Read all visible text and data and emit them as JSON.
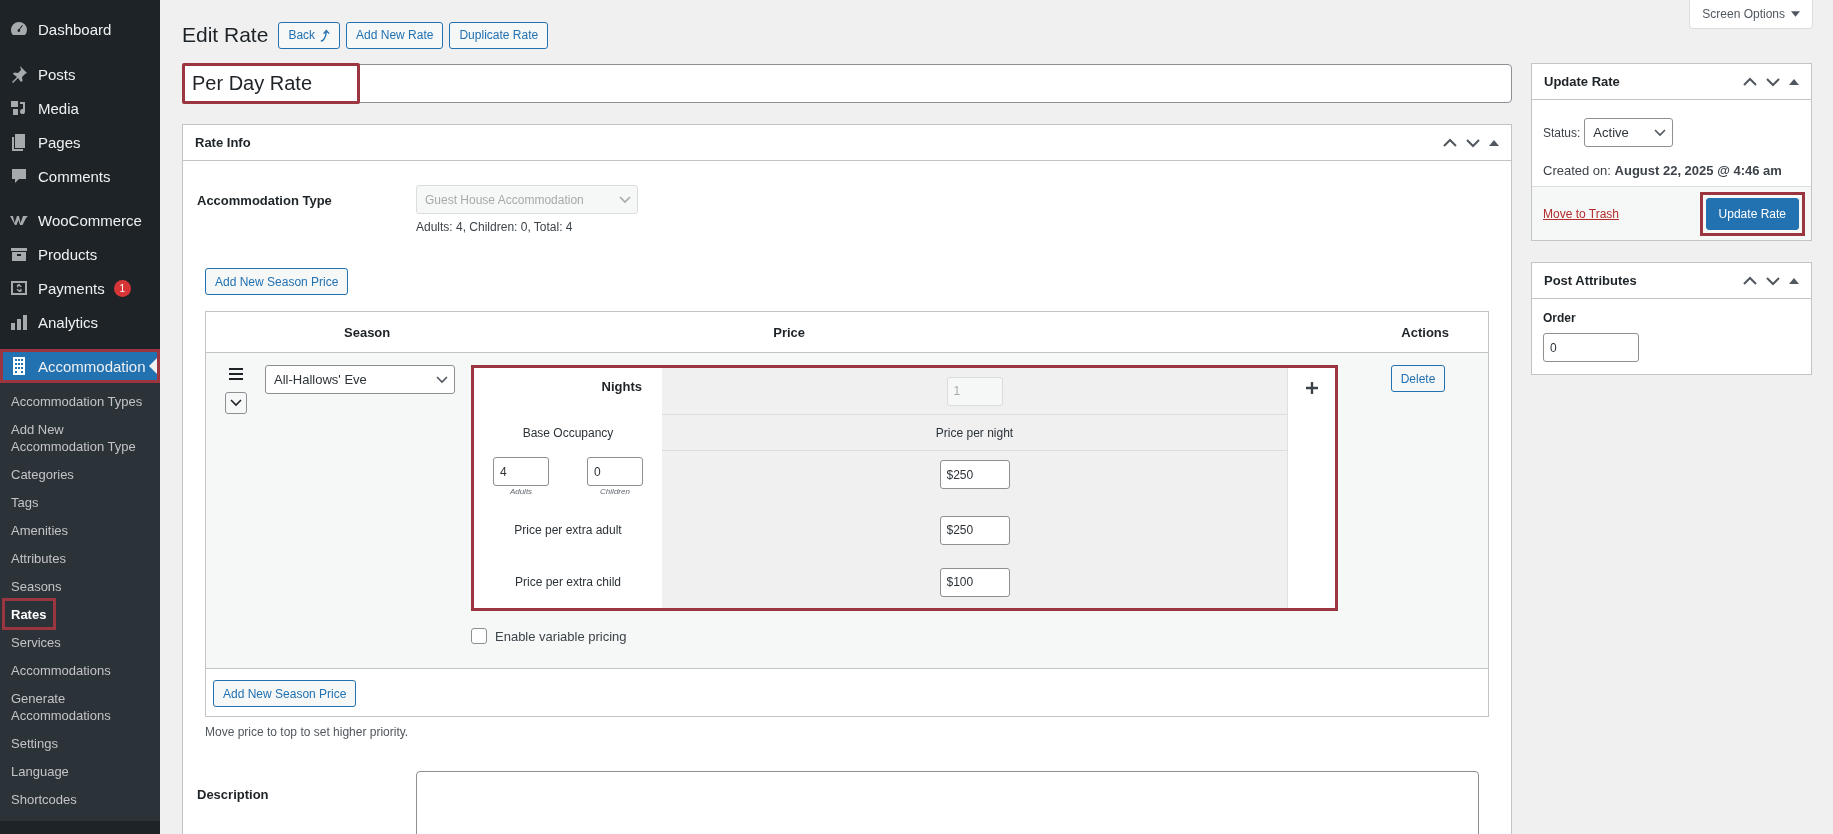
{
  "sidebar": {
    "groups": [
      {
        "items": [
          {
            "label": "Dashboard",
            "kind": "gauge",
            "current": false,
            "highlighted": false
          }
        ]
      },
      {
        "items": [
          {
            "label": "Posts",
            "kind": "pin",
            "current": false,
            "highlighted": false
          },
          {
            "label": "Media",
            "kind": "media",
            "current": false,
            "highlighted": false
          },
          {
            "label": "Pages",
            "kind": "pages",
            "current": false,
            "highlighted": false
          },
          {
            "label": "Comments",
            "kind": "comment",
            "current": false,
            "highlighted": false
          }
        ]
      },
      {
        "items": [
          {
            "label": "WooCommerce",
            "kind": "woo",
            "current": false,
            "highlighted": false
          },
          {
            "label": "Products",
            "kind": "box",
            "current": false,
            "highlighted": false
          },
          {
            "label": "Payments",
            "kind": "payment",
            "current": false,
            "highlighted": false,
            "badge": "1"
          },
          {
            "label": "Analytics",
            "kind": "bars",
            "current": false,
            "highlighted": false
          }
        ]
      },
      {
        "items": [
          {
            "label": "Accommodation",
            "kind": "building",
            "current": true,
            "highlighted": true,
            "children": [
              {
                "label": "Accommodation Types",
                "current": false,
                "highlighted": false
              },
              {
                "label": "Add New Accommodation Type",
                "current": false,
                "highlighted": false
              },
              {
                "label": "Categories",
                "current": false,
                "highlighted": false
              },
              {
                "label": "Tags",
                "current": false,
                "highlighted": false
              },
              {
                "label": "Amenities",
                "current": false,
                "highlighted": false
              },
              {
                "label": "Attributes",
                "current": false,
                "highlighted": false
              },
              {
                "label": "Seasons",
                "current": false,
                "highlighted": false
              },
              {
                "label": "Rates",
                "current": true,
                "highlighted": true
              },
              {
                "label": "Services",
                "current": false,
                "highlighted": false
              },
              {
                "label": "Accommodations",
                "current": false,
                "highlighted": false
              },
              {
                "label": "Generate Accommodations",
                "current": false,
                "highlighted": false
              },
              {
                "label": "Settings",
                "current": false,
                "highlighted": false
              },
              {
                "label": "Language",
                "current": false,
                "highlighted": false
              },
              {
                "label": "Shortcodes",
                "current": false,
                "highlighted": false
              }
            ]
          }
        ]
      }
    ]
  },
  "header": {
    "title": "Edit Rate",
    "buttons": [
      {
        "label": "Back",
        "kind": "back"
      },
      {
        "label": "Add New Rate",
        "kind": "plain"
      },
      {
        "label": "Duplicate Rate",
        "kind": "plain"
      }
    ]
  },
  "screen_options": "Screen Options",
  "title_field": {
    "value": "Per Day Rate",
    "highlighted": true
  },
  "rate_info": {
    "title": "Rate Info",
    "accommodation_type": {
      "label": "Accommodation Type",
      "value": "Guest House Accommodation",
      "disabled": true,
      "note": "Adults: 4, Children: 0, Total: 4"
    },
    "add_button": "Add New Season Price",
    "table": {
      "columns": [
        "Season",
        "Price",
        "Actions"
      ],
      "rows": [
        {
          "season": "All-Hallows' Eve",
          "action": "Delete",
          "prices": {
            "highlighted": true,
            "nights_label": "Nights",
            "nights_value": "1",
            "occupancy_label": "Base Occupancy",
            "per_night_label": "Price per night",
            "adults": {
              "value": "4",
              "caption": "Adults"
            },
            "children": {
              "value": "0",
              "caption": "Children"
            },
            "base_price": "$250",
            "extras": [
              {
                "label": "Price per extra adult",
                "value": "$250"
              },
              {
                "label": "Price per extra child",
                "value": "$100"
              }
            ]
          },
          "variable_pricing": {
            "label": "Enable variable pricing",
            "checked": false
          }
        }
      ],
      "footer_button": "Add New Season Price"
    },
    "hint": "Move price to top to set higher priority.",
    "description_label": "Description"
  },
  "update_panel": {
    "title": "Update Rate",
    "status_label": "Status:",
    "status": "Active",
    "created": "Created on: **August 22, 2025 @ 4:46 am**",
    "trash": "Move to Trash",
    "button": {
      "label": "Update Rate",
      "highlighted": true
    }
  },
  "attributes_panel": {
    "title": "Post Attributes",
    "order_label": "Order",
    "order_value": "0"
  }
}
